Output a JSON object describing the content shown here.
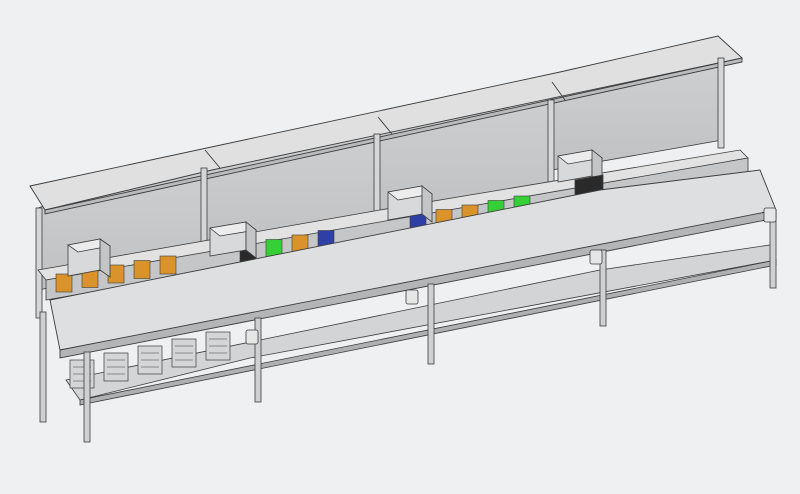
{
  "scene": {
    "subject": "",
    "colors": {
      "background": "#eef0f1",
      "surface_light": "#e2e2e2",
      "surface_mid": "#cfd0d1",
      "surface_dark": "#b3b5b7",
      "edge": "#3c3c3c",
      "bin_orange": "#d9932a",
      "bin_blue": "#2e3fa6",
      "bin_green": "#35d035",
      "bin_dark": "#2a2a2a"
    },
    "stations": [
      {
        "id": 1,
        "shelf_bins": [
          "orange",
          "orange",
          "orange",
          "orange",
          "orange"
        ],
        "tool_cells": 2
      },
      {
        "id": 2,
        "shelf_bins": [
          "dark",
          "green",
          "orange",
          "blue"
        ],
        "tool_cells": 2
      },
      {
        "id": 3,
        "shelf_bins": [
          "blue",
          "orange",
          "orange",
          "green",
          "green"
        ],
        "tool_cells": 2
      },
      {
        "id": 4,
        "shelf_bins": [],
        "tool_cells": 2
      }
    ]
  }
}
